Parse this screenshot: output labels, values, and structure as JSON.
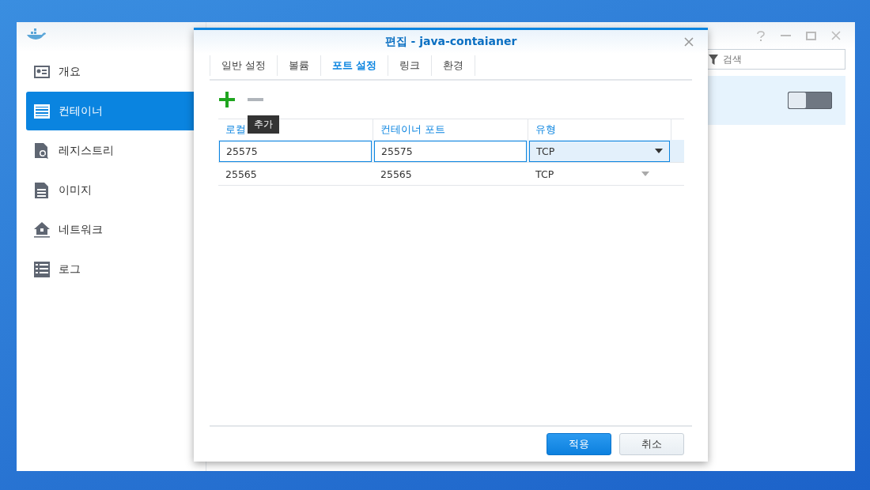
{
  "sidebar": {
    "items": [
      {
        "label": "개요",
        "selected": false
      },
      {
        "label": "컨테이너",
        "selected": true
      },
      {
        "label": "레지스트리",
        "selected": false
      },
      {
        "label": "이미지",
        "selected": false
      },
      {
        "label": "네트워크",
        "selected": false
      },
      {
        "label": "로그",
        "selected": false
      }
    ]
  },
  "search": {
    "placeholder": "검색"
  },
  "container_row": {
    "on": false
  },
  "dialog": {
    "title": "편집 - java-contaianer",
    "tabs": [
      {
        "label": "일반 설정",
        "selected": false
      },
      {
        "label": "볼륨",
        "selected": false
      },
      {
        "label": "포트 설정",
        "selected": true
      },
      {
        "label": "링크",
        "selected": false
      },
      {
        "label": "환경",
        "selected": false
      }
    ],
    "remove_disabled": true,
    "tooltip": "추가",
    "table": {
      "columns": [
        "로컬",
        "컨테이너 포트",
        "유형"
      ],
      "rows": [
        {
          "local": "25575",
          "container": "25575",
          "type": "TCP",
          "selected": true
        },
        {
          "local": "25565",
          "container": "25565",
          "type": "TCP",
          "selected": false
        }
      ]
    },
    "buttons": [
      {
        "label": "적용",
        "kind": "primary"
      },
      {
        "label": "취소",
        "kind": "secondary"
      }
    ]
  }
}
